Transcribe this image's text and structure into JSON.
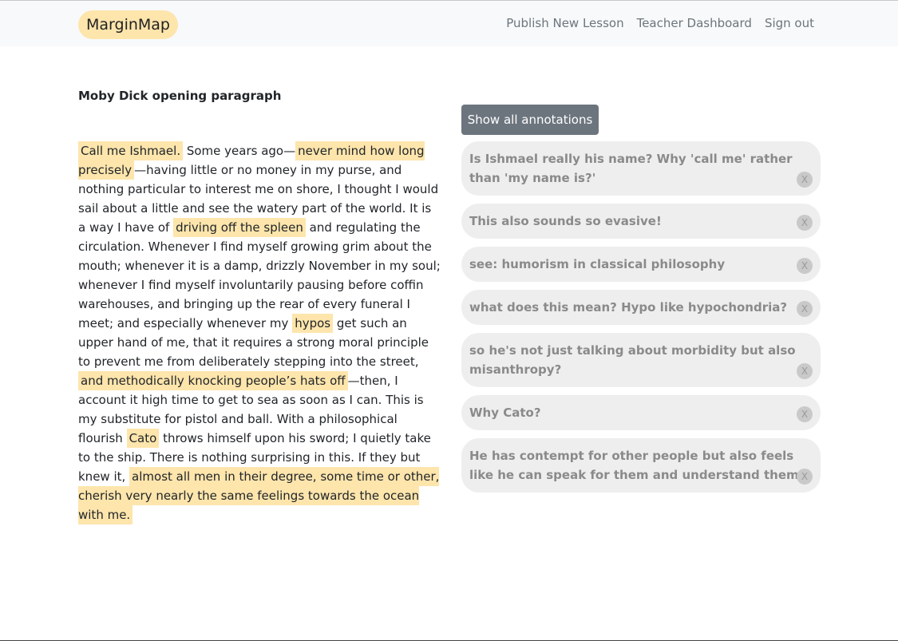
{
  "nav": {
    "brand": "MarginMap",
    "links": [
      "Publish New Lesson",
      "Teacher Dashboard",
      "Sign out"
    ]
  },
  "lesson": {
    "title": "Moby Dick opening paragraph",
    "segments": [
      {
        "text": "Call me Ishmael.",
        "highlight": true
      },
      {
        "text": " Some years ago—",
        "highlight": false
      },
      {
        "text": "never mind how long precisely",
        "highlight": true
      },
      {
        "text": "—having little or no money in my purse, and nothing particular to interest me on shore, I thought I would sail about a little and see the watery part of the world. It is a way I have of ",
        "highlight": false
      },
      {
        "text": "driving off the spleen",
        "highlight": true
      },
      {
        "text": " and regulating the circulation. Whenever I find myself growing grim about the mouth; whenever it is a damp, drizzly November in my soul; whenever I find myself involuntarily pausing before coffin warehouses, and bringing up the rear of every funeral I meet; and especially whenever my ",
        "highlight": false
      },
      {
        "text": "hypos",
        "highlight": true
      },
      {
        "text": " get such an upper hand of me, that it requires a strong moral principle to prevent me from deliberately stepping into the street, ",
        "highlight": false
      },
      {
        "text": "and methodically knocking people’s hats off",
        "highlight": true
      },
      {
        "text": "—then, I account it high time to get to sea as soon as I can. This is my substitute for pistol and ball. With a philosophical flourish ",
        "highlight": false
      },
      {
        "text": "Cato",
        "highlight": true
      },
      {
        "text": " throws himself upon his sword; I quietly take to the ship. There is nothing surprising in this. If they but knew it, ",
        "highlight": false
      },
      {
        "text": "almost all men in their degree, some time or other, cherish very nearly the same feelings towards the ocean with me.",
        "highlight": true
      }
    ]
  },
  "annotations_panel": {
    "show_all_label": "Show all annotations",
    "delete_label": "X",
    "items": [
      "Is Ishmael really his name? Why 'call me' rather than 'my name is?'",
      "This also sounds so evasive!",
      "see: humorism in classical philosophy",
      "what does this mean? Hypo like hypochondria?",
      "so he's not just talking about morbidity but also misanthropy?",
      "Why Cato?",
      "He has contempt for other people but also feels like he can speak for them and understand them."
    ]
  },
  "colors": {
    "highlight": "#fde5ac",
    "button": "#6c757d",
    "annotation_bg": "#eeeeee",
    "annotation_text": "#8a8a8a",
    "navbar_bg": "#f8f9fa"
  }
}
